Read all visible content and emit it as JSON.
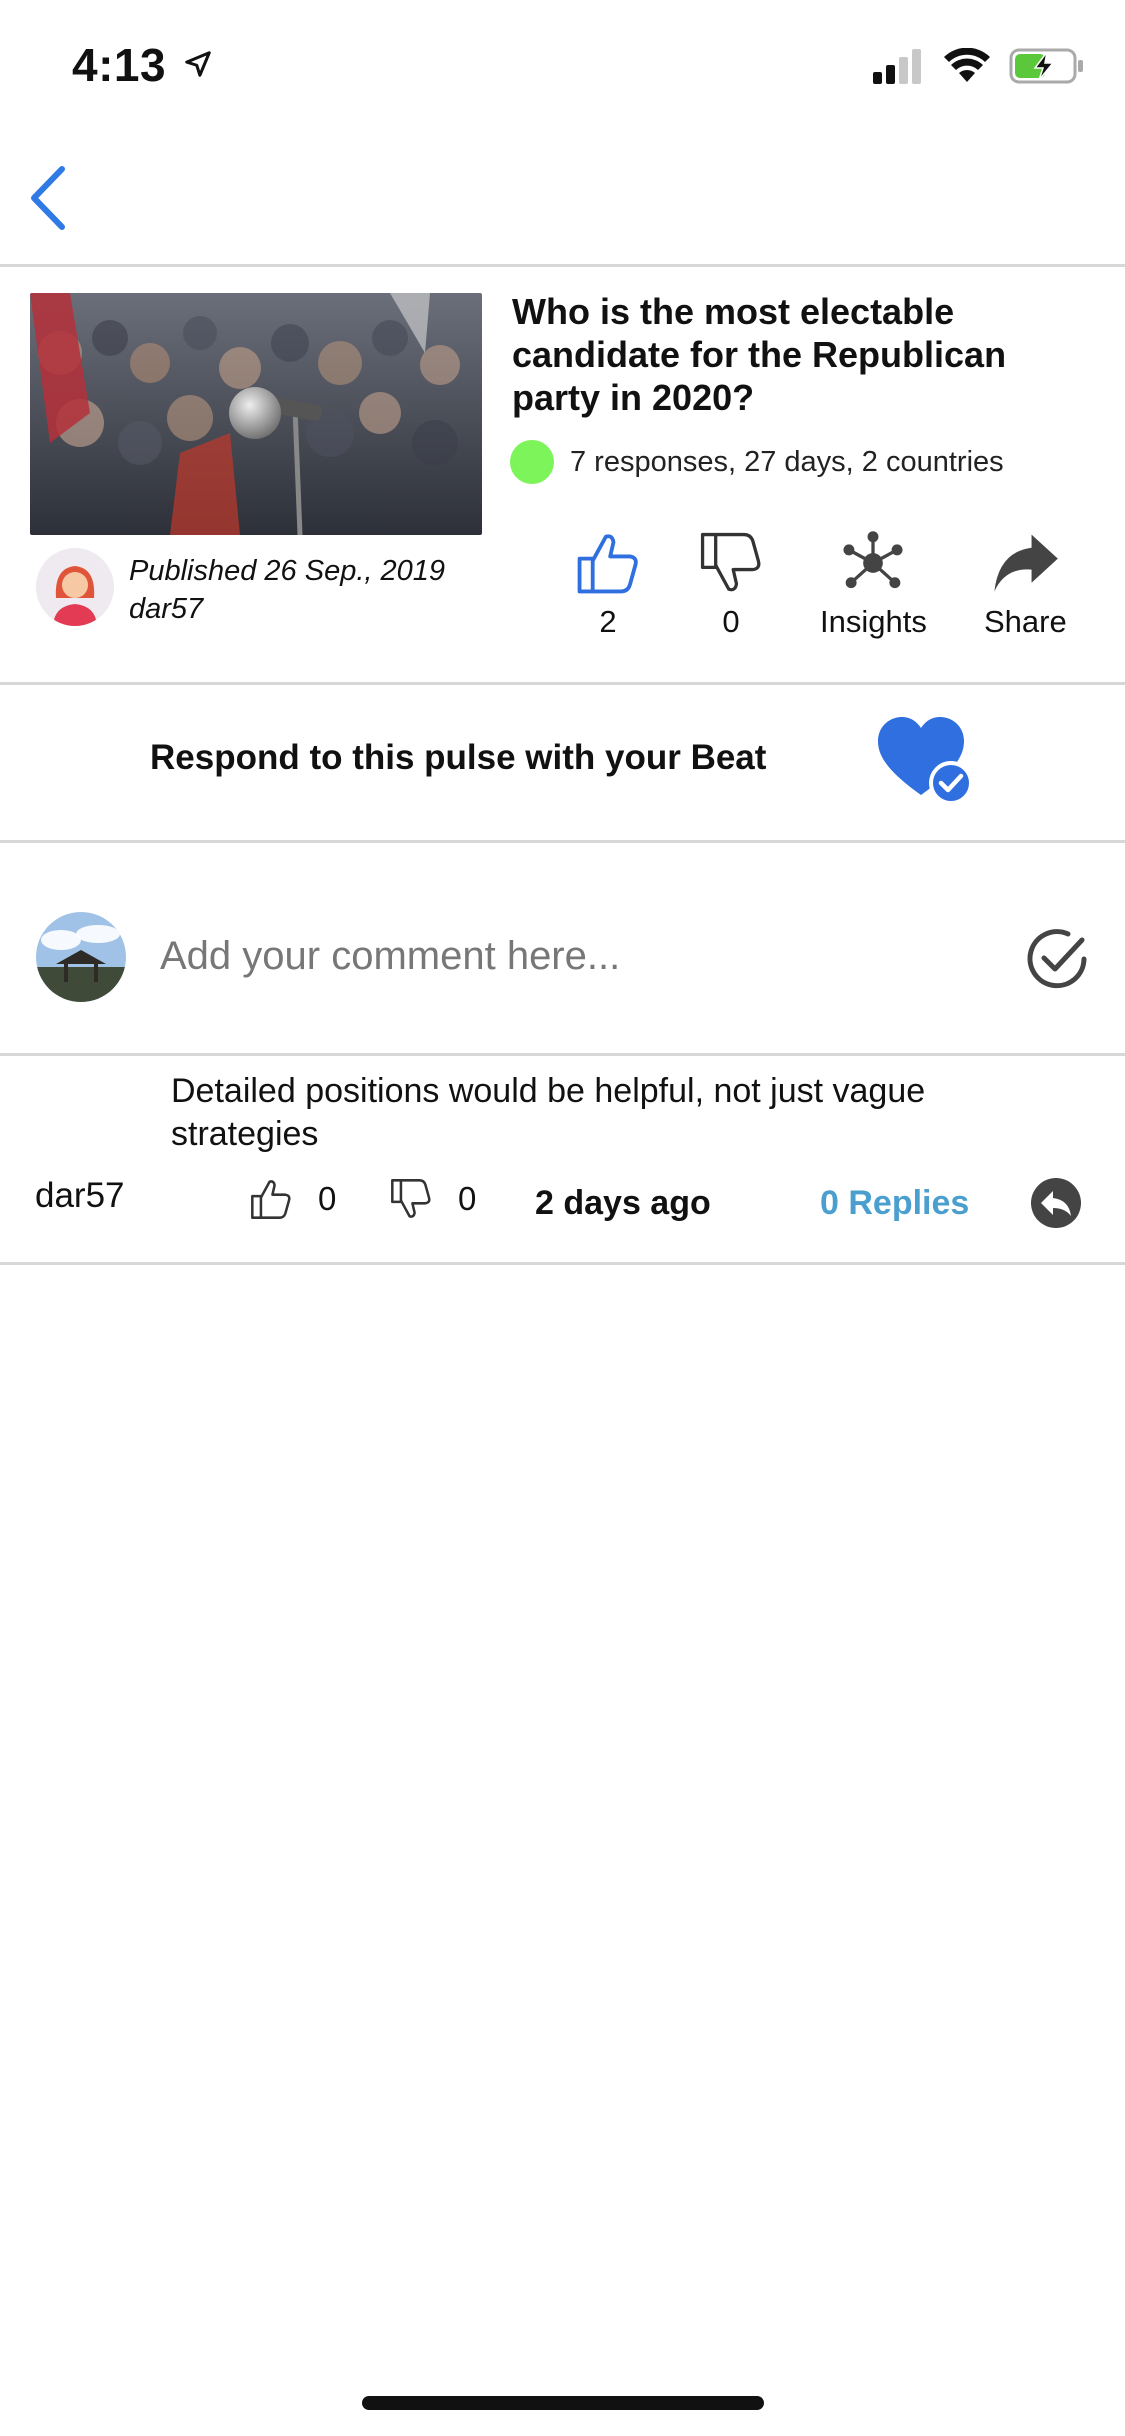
{
  "status_bar": {
    "time": "4:13"
  },
  "nav": {
    "back_icon": "chevron-left-icon"
  },
  "post": {
    "title": "Who is the most electable candidate for the Republican party in 2020?",
    "meta": "7 responses, 27 days, 2 countries",
    "status_color": "#7cf45a",
    "published": "Published 26 Sep., 2019",
    "author": "dar57",
    "likes": "2",
    "dislikes": "0",
    "insights_label": "Insights",
    "share_label": "Share"
  },
  "respond": {
    "label": "Respond to this pulse with your Beat",
    "icon": "heart-check-icon",
    "accent": "#2f6fe0"
  },
  "comment_box": {
    "placeholder": "Add your comment here..."
  },
  "comments": [
    {
      "text": "Detailed positions would be helpful, not just vague strategies",
      "user": "dar57",
      "likes": "0",
      "dislikes": "0",
      "time": "2 days ago",
      "replies": "0 Replies"
    }
  ]
}
